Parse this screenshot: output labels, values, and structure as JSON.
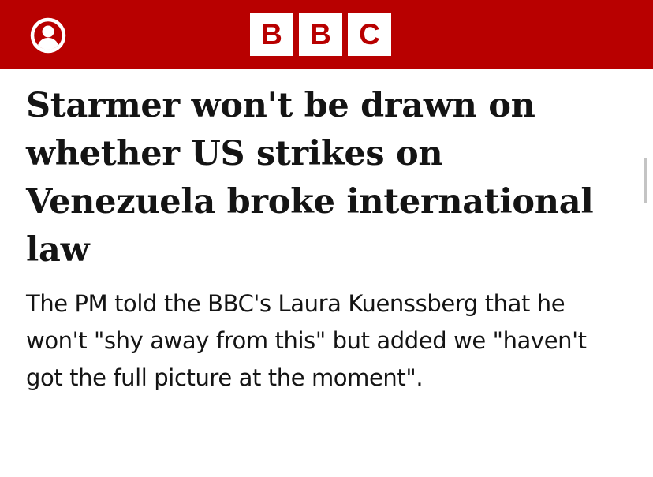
{
  "header": {
    "brand_color": "#b80000",
    "account_icon": "account-icon",
    "logo_letters": [
      "B",
      "B",
      "C"
    ]
  },
  "article": {
    "headline": "Starmer won't be drawn on whether US strikes on Venezuela broke international law",
    "summary": "The PM told the BBC's Laura Kuenssberg that he won't \"shy away from this\" but added we \"haven't got the full picture at the moment\"."
  }
}
